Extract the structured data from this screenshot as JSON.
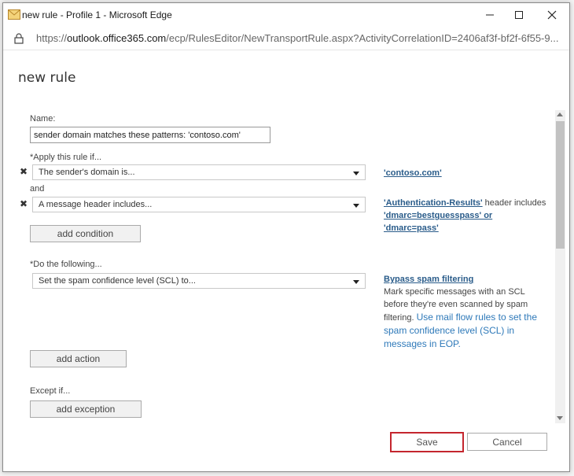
{
  "window": {
    "title": "new rule - Profile 1 - Microsoft Edge",
    "minimize_icon": "minimize-icon",
    "maximize_icon": "maximize-icon",
    "close_icon": "close-icon"
  },
  "address": {
    "prefix": "https://",
    "host": "outlook.office365.com",
    "path": "/ecp/RulesEditor/NewTransportRule.aspx?ActivityCorrelationID=2406af3f-bf2f-6f55-9..."
  },
  "page": {
    "title": "new rule"
  },
  "form": {
    "name_label": "Name:",
    "name_value": "sender domain matches these patterns: 'contoso.com'",
    "apply_label": "*Apply this rule if...",
    "condition1": "The sender's domain is...",
    "condition1_value": "'contoso.com'",
    "and_label": "and",
    "condition2": "A message header includes...",
    "condition2_header": "'Authentication-Results'",
    "condition2_mid": " header includes",
    "condition2_values": "'dmarc=bestguesspass' or 'dmarc=pass'",
    "add_condition": "add condition",
    "do_label": "*Do the following...",
    "action1": "Set the spam confidence level (SCL) to...",
    "action1_link": "Bypass spam filtering",
    "action1_desc": "Mark specific messages with an SCL before they're even scanned by spam filtering.",
    "action1_help": "Use mail flow rules to set the spam confidence level (SCL) in messages in EOP.",
    "add_action": "add action",
    "except_label": "Except if...",
    "add_exception": "add exception"
  },
  "footer": {
    "save": "Save",
    "cancel": "Cancel"
  },
  "colors": {
    "save_border": "#c4262e",
    "link": "#2a5c8a",
    "help_link": "#2e79b9"
  }
}
